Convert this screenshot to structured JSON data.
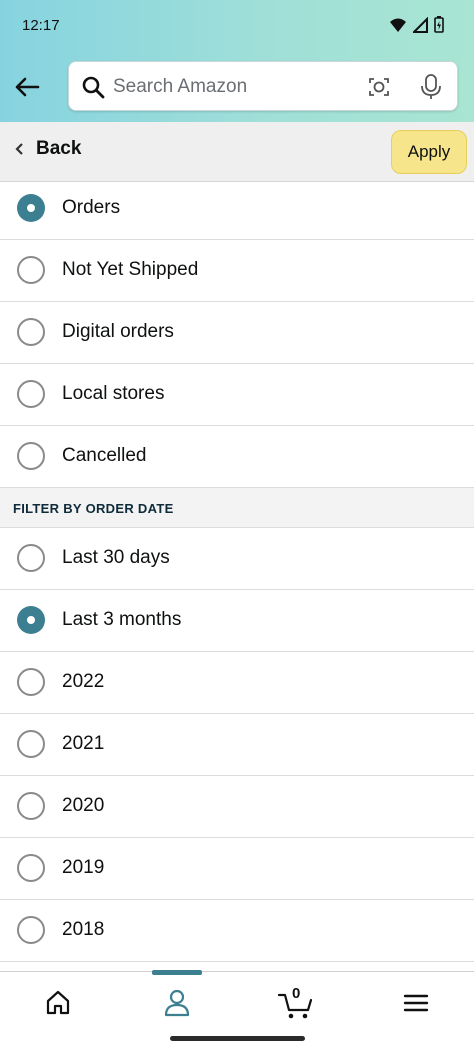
{
  "status_bar": {
    "time": "12:17"
  },
  "header": {
    "search_placeholder": "Search Amazon",
    "icons": [
      "back-arrow-icon",
      "search-icon",
      "camera-icon",
      "microphone-icon"
    ]
  },
  "toolbar": {
    "back_label": "Back",
    "apply_label": "Apply"
  },
  "order_types": [
    {
      "label": "Orders",
      "checked": true
    },
    {
      "label": "Not Yet Shipped",
      "checked": false
    },
    {
      "label": "Digital orders",
      "checked": false
    },
    {
      "label": "Local stores",
      "checked": false
    },
    {
      "label": "Cancelled",
      "checked": false
    }
  ],
  "date_section": {
    "title": "FILTER BY ORDER DATE",
    "options": [
      {
        "label": "Last 30 days",
        "checked": false
      },
      {
        "label": "Last 3 months",
        "checked": true
      },
      {
        "label": "2022",
        "checked": false
      },
      {
        "label": "2021",
        "checked": false
      },
      {
        "label": "2020",
        "checked": false
      },
      {
        "label": "2019",
        "checked": false
      },
      {
        "label": "2018",
        "checked": false
      }
    ]
  },
  "bottom_nav": {
    "cart_count": "0",
    "items": [
      "home-icon",
      "account-icon",
      "cart-icon",
      "menu-icon"
    ],
    "active": "account-icon"
  },
  "colors": {
    "accent": "#3c7f91",
    "apply_button": "#f7e58b",
    "header_gradient_start": "#86d3e0",
    "header_gradient_end": "#a9e5d2"
  }
}
